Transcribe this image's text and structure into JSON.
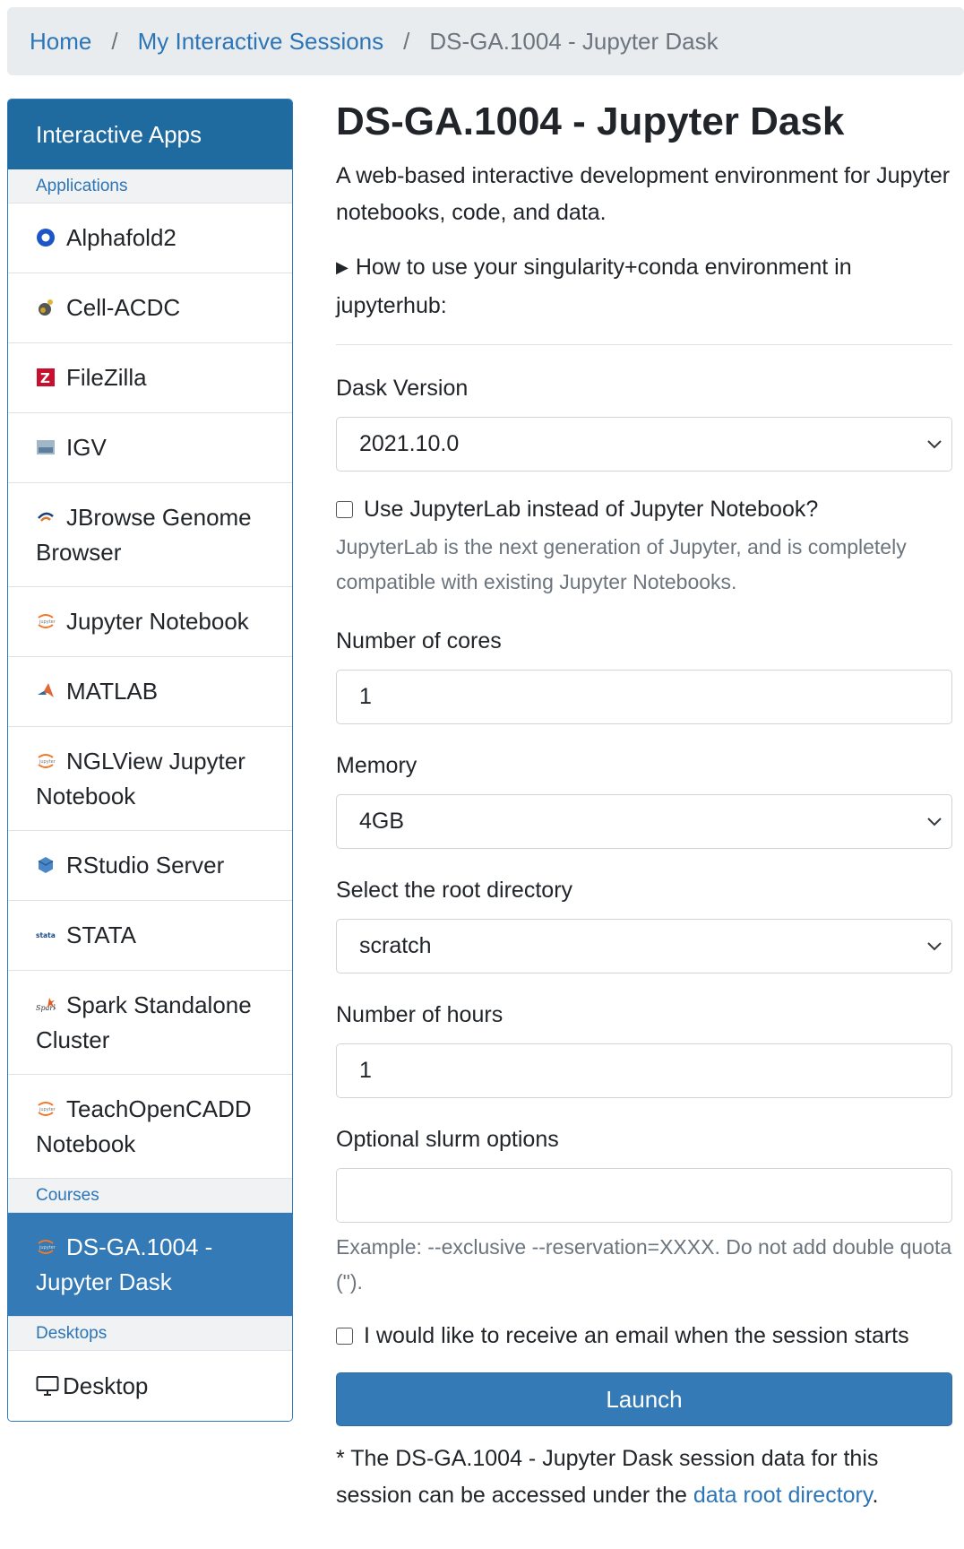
{
  "breadcrumb": {
    "home": "Home",
    "sessions": "My Interactive Sessions",
    "current": "DS-GA.1004 - Jupyter Dask",
    "separator": "/"
  },
  "sidebar": {
    "header": "Interactive Apps",
    "sections": {
      "applications": "Applications",
      "courses": "Courses",
      "desktops": "Desktops"
    },
    "applications": [
      {
        "line1": "Alphafold2",
        "icon": "alphafold-icon"
      },
      {
        "line1": "Cell-ACDC",
        "icon": "cell-acdc-icon"
      },
      {
        "line1": "FileZilla",
        "icon": "filezilla-icon"
      },
      {
        "line1": "IGV",
        "icon": "igv-icon"
      },
      {
        "line1": "JBrowse Genome",
        "line2": "Browser",
        "icon": "jbrowse-icon"
      },
      {
        "line1": "Jupyter Notebook",
        "icon": "jupyter-icon"
      },
      {
        "line1": "MATLAB",
        "icon": "matlab-icon"
      },
      {
        "line1": "NGLView Jupyter",
        "line2": "Notebook",
        "icon": "jupyter-icon"
      },
      {
        "line1": "RStudio Server",
        "icon": "rstudio-icon"
      },
      {
        "line1": "STATA",
        "icon": "stata-icon"
      },
      {
        "line1": "Spark Standalone",
        "line2": "Cluster",
        "icon": "spark-icon"
      },
      {
        "line1": "TeachOpenCADD",
        "line2": "Notebook",
        "icon": "jupyter-icon"
      }
    ],
    "courses": [
      {
        "line1": "DS-GA.1004 -",
        "line2": "Jupyter Dask",
        "icon": "jupyter-icon"
      }
    ],
    "desktops": [
      {
        "line1": "Desktop",
        "icon": "monitor-icon"
      }
    ]
  },
  "main": {
    "title": "DS-GA.1004 - Jupyter Dask",
    "description": "A web-based interactive development environment for Jupyter notebooks, code, and data.",
    "howto": "How to use your singularity+conda environment in jupyterhub:",
    "dask_version": {
      "label": "Dask Version",
      "value": "2021.10.0"
    },
    "jupyterlab": {
      "label": "Use JupyterLab instead of Jupyter Notebook?",
      "help": "JupyterLab is the next generation of Jupyter, and is completely compatible with existing Jupyter Notebooks."
    },
    "cores": {
      "label": "Number of cores",
      "value": "1"
    },
    "memory": {
      "label": "Memory",
      "value": "4GB"
    },
    "root_dir": {
      "label": "Select the root directory",
      "value": "scratch"
    },
    "hours": {
      "label": "Number of hours",
      "value": "1"
    },
    "slurm": {
      "label": "Optional slurm options",
      "value": "",
      "help": "Example: --exclusive --reservation=XXXX. Do not add double quota (\")."
    },
    "email": {
      "label": "I would like to receive an email when the session starts"
    },
    "launch": "Launch",
    "footnote": {
      "text": "* The DS-GA.1004 - Jupyter Dask session data for this session can be accessed under the ",
      "link": "data root directory",
      "end": "."
    }
  },
  "colors": {
    "primary": "#337ab7",
    "sidebar_header": "#1f6ba0",
    "link": "#2c75b6",
    "muted": "#6c757d",
    "breadcrumb_bg": "#e9ecef"
  }
}
